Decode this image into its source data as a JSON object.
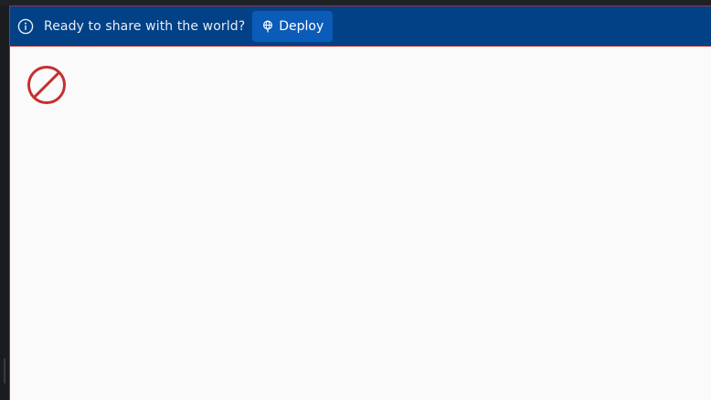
{
  "banner": {
    "message": "Ready to share with the world?",
    "info_icon": "info-circle-icon",
    "deploy_label": "Deploy",
    "deploy_icon": "globe-pin-icon",
    "background_color": "#024186",
    "button_color": "#0b5bb8"
  },
  "content": {
    "status_icon": "prohibited-icon",
    "status_icon_color": "#c62f30",
    "background_color": "#fafafa"
  }
}
